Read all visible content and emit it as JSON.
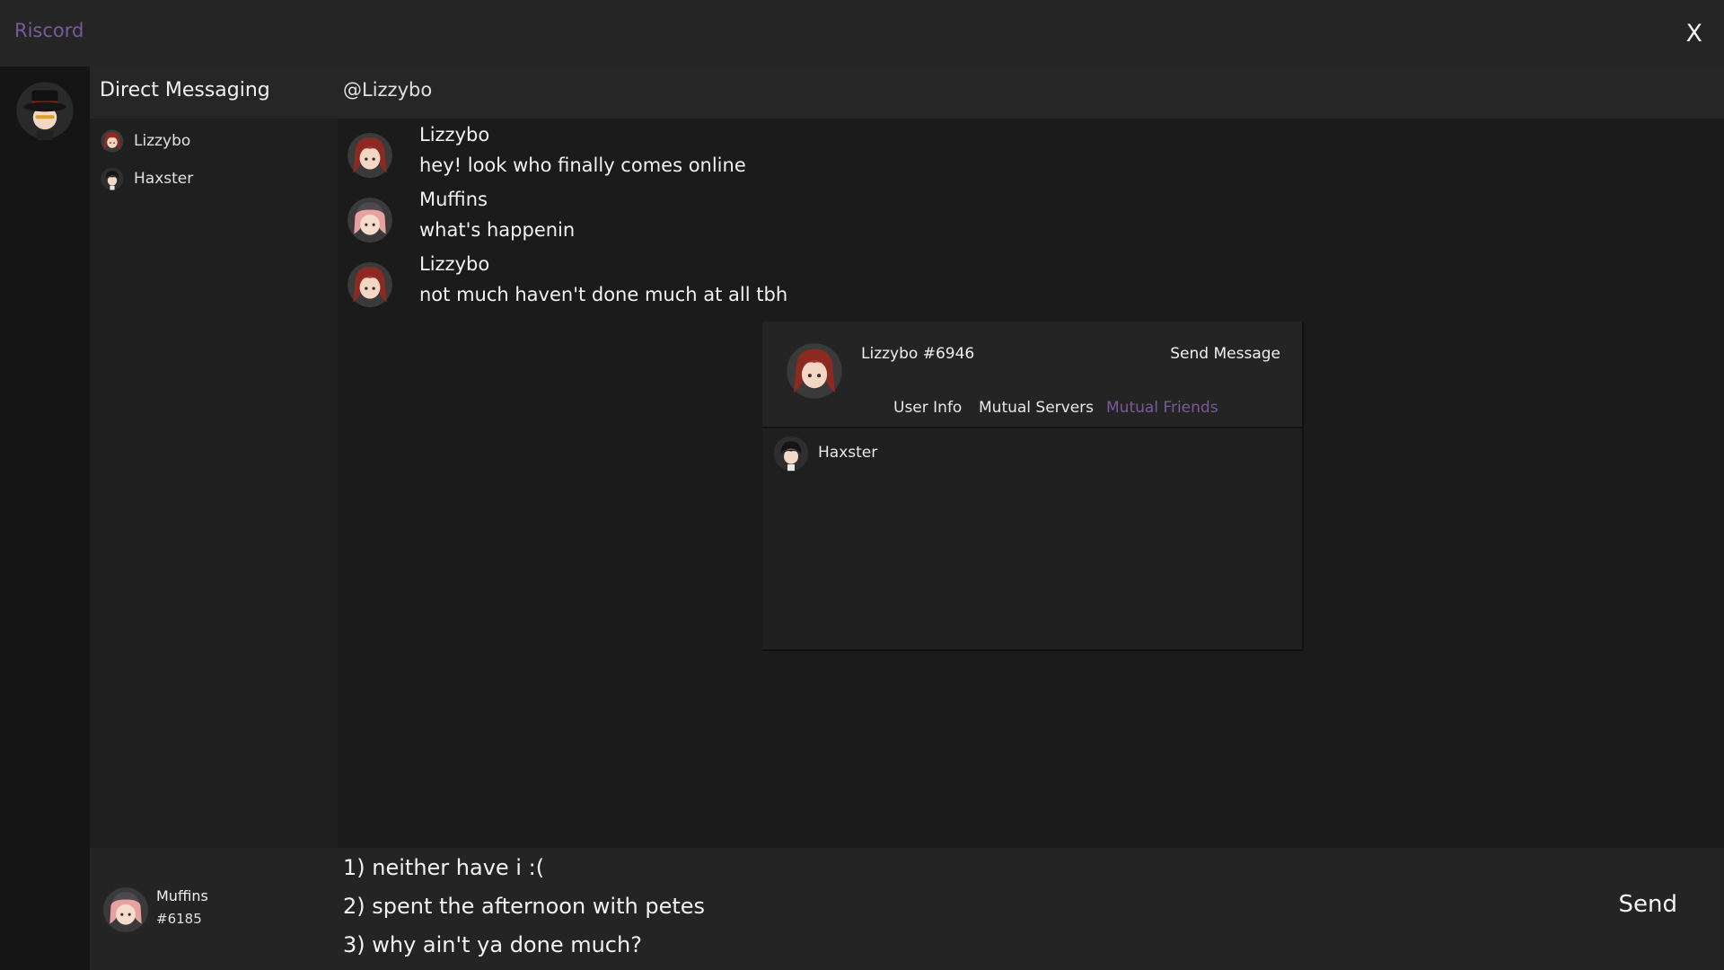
{
  "app": {
    "title": "Riscord",
    "close_label": "X"
  },
  "sidebar": {
    "title": "Direct Messaging",
    "items": [
      {
        "label": "Lizzybo"
      },
      {
        "label": "Haxster"
      }
    ]
  },
  "chat": {
    "header": "@Lizzybo",
    "messages": [
      {
        "author": "Lizzybo",
        "text": "hey! look who finally comes online"
      },
      {
        "author": "Muffins",
        "text": "what's happenin"
      },
      {
        "author": "Lizzybo",
        "text": "not much haven't done much at all tbh"
      }
    ]
  },
  "profile": {
    "name": "Lizzybo #6946",
    "send_message_label": "Send Message",
    "tabs": [
      {
        "label": "User Info",
        "active": false
      },
      {
        "label": "Mutual Servers",
        "active": false
      },
      {
        "label": "Mutual Friends",
        "active": true
      }
    ],
    "friends": [
      {
        "label": "Haxster"
      }
    ]
  },
  "footer": {
    "user_name": "Muffins",
    "user_tag": "#6185",
    "options": [
      {
        "label": "1) neither have i :("
      },
      {
        "label": "2) spent the afternoon with petes"
      },
      {
        "label": "3) why ain't ya done much?"
      }
    ],
    "send_label": "Send"
  },
  "colors": {
    "accent": "#7a5a9a",
    "background": "#1b1b1b",
    "panel": "#242424",
    "text": "#f2f2f2"
  }
}
